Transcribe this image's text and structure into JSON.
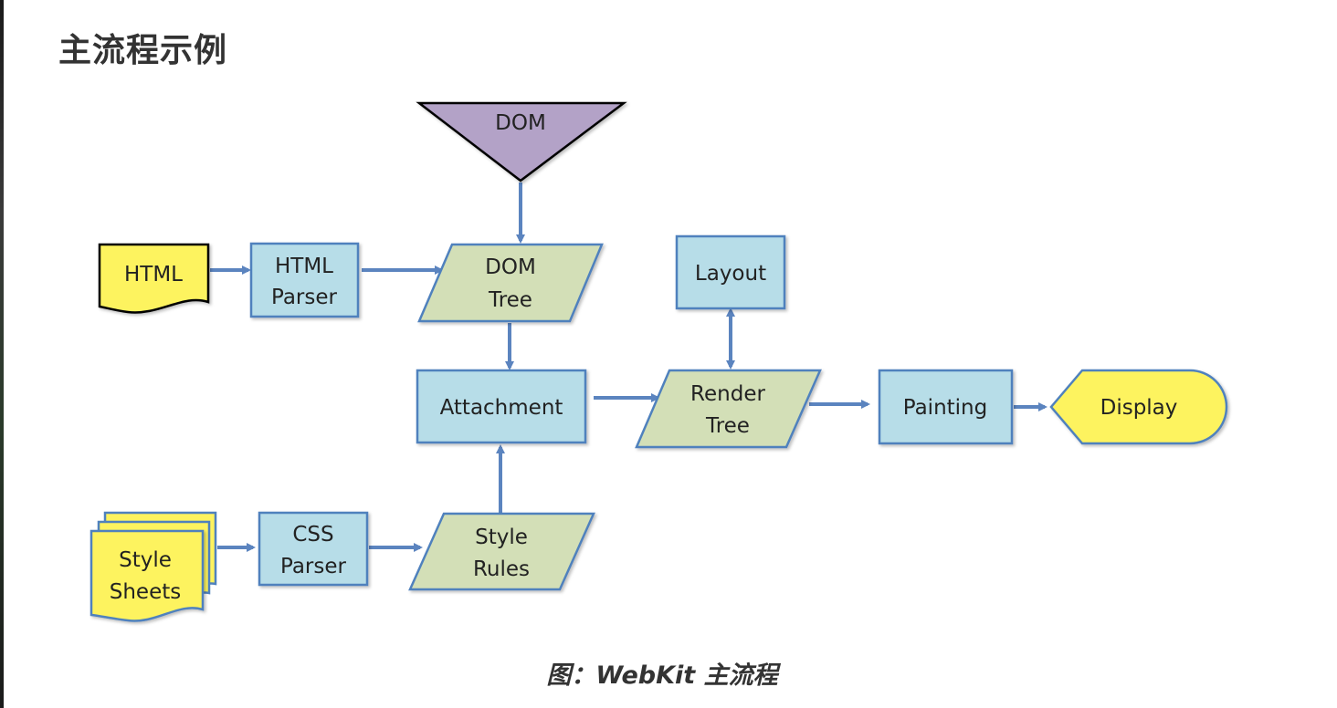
{
  "page": {
    "title": "主流程示例",
    "caption": "图：WebKit 主流程"
  },
  "colors": {
    "process_fill": "#b7dde8",
    "data_fill": "#d3dfb7",
    "terminal_fill": "#fdf35e",
    "dom_fill": "#b3a2c7",
    "stroke": "#4f81bd",
    "arrow": "#5b84bf"
  },
  "nodes": {
    "html": {
      "lines": [
        "HTML"
      ]
    },
    "html_parser": {
      "lines": [
        "HTML",
        "Parser"
      ]
    },
    "dom": {
      "lines": [
        "DOM"
      ]
    },
    "dom_tree": {
      "lines": [
        "DOM",
        "Tree"
      ]
    },
    "layout": {
      "lines": [
        "Layout"
      ]
    },
    "attachment": {
      "lines": [
        "Attachment"
      ]
    },
    "render_tree": {
      "lines": [
        "Render",
        "Tree"
      ]
    },
    "painting": {
      "lines": [
        "Painting"
      ]
    },
    "display": {
      "lines": [
        "Display"
      ]
    },
    "style_sheets": {
      "lines": [
        "Style",
        "Sheets"
      ]
    },
    "css_parser": {
      "lines": [
        "CSS",
        "Parser"
      ]
    },
    "style_rules": {
      "lines": [
        "Style",
        "Rules"
      ]
    }
  }
}
